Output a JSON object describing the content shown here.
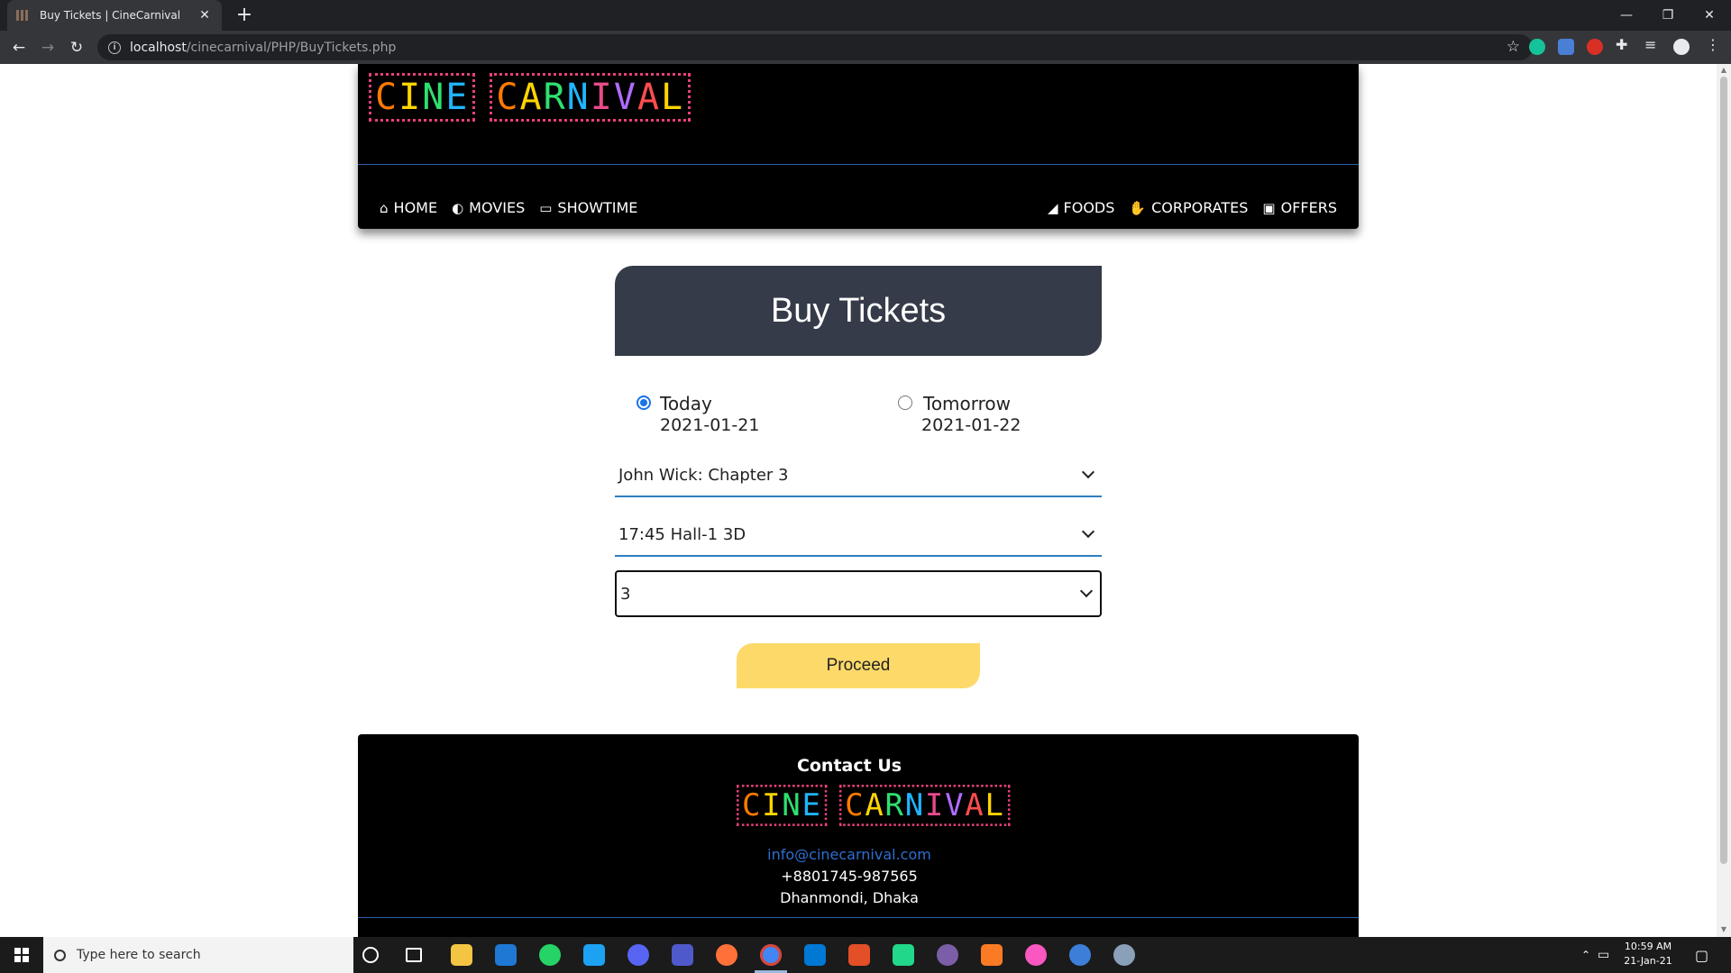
{
  "browser": {
    "tab_title": "Buy Tickets | CineCarnival",
    "tab_close": "✕",
    "new_tab": "+",
    "url_host": "localhost",
    "url_path": "/cinecarnival/PHP/BuyTickets.php",
    "back": "←",
    "forward": "→",
    "reload": "↻",
    "star": "☆",
    "minimize": "—",
    "restore": "❐",
    "close": "✕"
  },
  "logo": {
    "word1": [
      "C",
      "I",
      "N",
      "E"
    ],
    "word2": [
      "C",
      "A",
      "R",
      "N",
      "I",
      "V",
      "A",
      "L"
    ],
    "colors": [
      "#ff7a00",
      "#ffd400",
      "#2ee06f",
      "#1fb5ff",
      "#e84b8a",
      "#b06cff",
      "#ff4d4d",
      "#ffd400"
    ]
  },
  "menu": {
    "left": [
      {
        "icon": "⌂",
        "label": "HOME"
      },
      {
        "icon": "◐",
        "label": "MOVIES"
      },
      {
        "icon": "▭",
        "label": "SHOWTIME"
      }
    ],
    "right": [
      {
        "icon": "◢",
        "label": "FOODS"
      },
      {
        "icon": "✋",
        "label": "CORPORATES"
      },
      {
        "icon": "▣",
        "label": "OFFERS"
      }
    ]
  },
  "buy": {
    "title": "Buy Tickets",
    "day_options": [
      {
        "label": "Today",
        "date": "2021-01-21",
        "checked": true
      },
      {
        "label": "Tomorrow",
        "date": "2021-01-22",
        "checked": false
      }
    ],
    "movie_select": "John Wick: Chapter 3",
    "show_select": "17:45 Hall-1 3D",
    "ticket_count_select": "3",
    "proceed_label": "Proceed"
  },
  "footer": {
    "title": "Contact Us",
    "email": "info@cinecarnival.com",
    "phone": "+8801745-987565",
    "address": "Dhanmondi, Dhaka"
  },
  "taskbar": {
    "search_placeholder": "Type here to search",
    "time": "10:59 AM",
    "date": "21-Jan-21"
  }
}
